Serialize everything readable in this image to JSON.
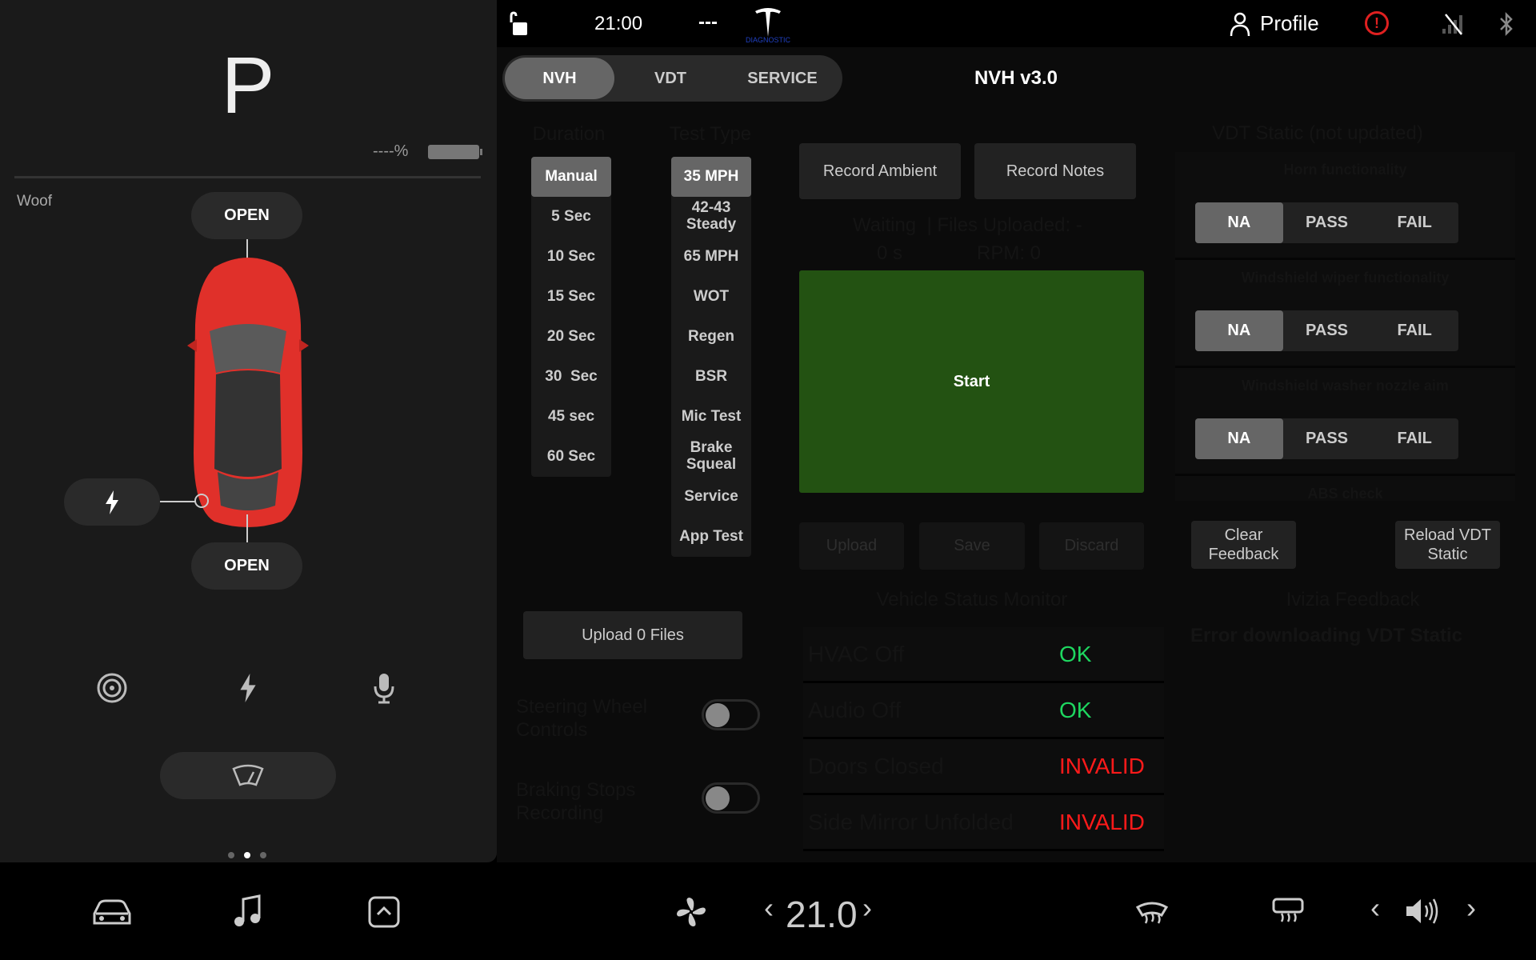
{
  "left_panel": {
    "gear": "P",
    "battery_text": "----%",
    "battery_level_percent": 100,
    "vehicle_name": "Woof",
    "frunk_button": "OPEN",
    "trunk_button": "OPEN",
    "quick_icons": [
      "camera-icon",
      "lightning-icon",
      "microphone-icon"
    ],
    "wiper_icon": "wiper-icon",
    "page_dots": 3,
    "active_page": 1
  },
  "status_bar": {
    "time": "21:00",
    "temp_outside": "---",
    "logo_caption": "DIAGNOSTIC",
    "profile": "Profile",
    "alert_color": "#e02020"
  },
  "tabs": [
    {
      "label": "NVH",
      "active": true
    },
    {
      "label": "VDT",
      "active": false
    },
    {
      "label": "SERVICE",
      "active": false
    }
  ],
  "page_title": "NVH v3.0",
  "duration": {
    "title": "Duration",
    "options": [
      "Manual",
      "5 Sec",
      "10 Sec",
      "15 Sec",
      "20 Sec",
      "30  Sec",
      "45 sec",
      "60 Sec"
    ],
    "selected": "Manual"
  },
  "test_type": {
    "title": "Test Type",
    "options": [
      "35 MPH",
      "42-43 Steady",
      "65 MPH",
      "WOT",
      "Regen",
      "BSR",
      "Mic Test",
      "Brake Squeal",
      "Service",
      "App Test"
    ],
    "selected": "35 MPH"
  },
  "record": {
    "ambient": "Record Ambient",
    "notes": "Record Notes",
    "status": "Waiting  | Files Uploaded: -",
    "elapsed": "0 s",
    "rpm": "RPM: 0",
    "start": "Start",
    "start_color": "#235212",
    "upload": "Upload",
    "save": "Save",
    "discard": "Discard"
  },
  "upload_files": "Upload 0 Files",
  "toggles": [
    {
      "label": "Steering Wheel Controls",
      "on": false
    },
    {
      "label": "Braking Stops Recording",
      "on": false
    }
  ],
  "vehicle_status": {
    "title": "Vehicle Status Monitor",
    "rows": [
      {
        "name": "HVAC Off",
        "status": "OK",
        "color": "#1ed760"
      },
      {
        "name": "Audio Off",
        "status": "OK",
        "color": "#1ed760"
      },
      {
        "name": "Doors Closed",
        "status": "INVALID",
        "color": "#ff1a1a"
      },
      {
        "name": "Side Mirror Unfolded",
        "status": "INVALID",
        "color": "#ff1a1a"
      }
    ]
  },
  "vdt_static": {
    "title": "VDT Static (not updated)",
    "options": [
      "NA",
      "PASS",
      "FAIL"
    ],
    "items": [
      {
        "label": "Horn functionality",
        "selected": "NA"
      },
      {
        "label": "Windshield wiper functionality",
        "selected": "NA"
      },
      {
        "label": "Windshield washer nozzle aim",
        "selected": "NA"
      },
      {
        "label": "ABS check"
      }
    ],
    "clear_feedback": "Clear Feedback",
    "reload": "Reload VDT Static"
  },
  "ivizia": {
    "title": "Ivizia Feedback",
    "message": "Error downloading VDT Static"
  },
  "bottom_bar": {
    "temperature": "21.0",
    "icons": [
      "car-icon",
      "music-icon",
      "app-launcher-icon",
      "fan-icon",
      "front-defrost-icon",
      "rear-defrost-icon",
      "volume-icon"
    ]
  }
}
